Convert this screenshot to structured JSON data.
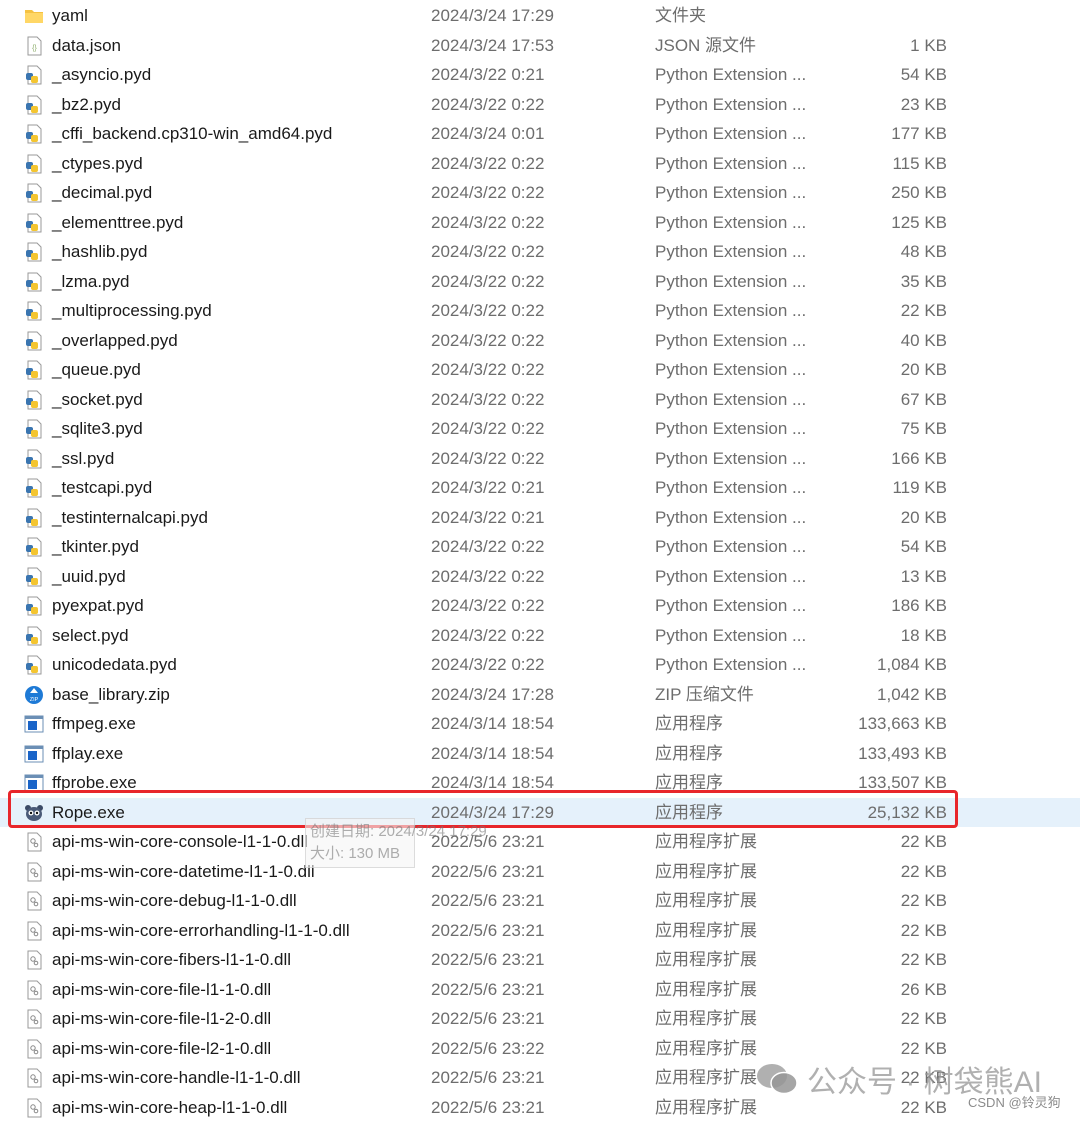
{
  "files": [
    {
      "name": "yaml",
      "date": "2024/3/24 17:29",
      "type": "文件夹",
      "size": "",
      "icon": "folder"
    },
    {
      "name": "data.json",
      "date": "2024/3/24 17:53",
      "type": "JSON 源文件",
      "size": "1 KB",
      "icon": "json"
    },
    {
      "name": "_asyncio.pyd",
      "date": "2024/3/22 0:21",
      "type": "Python Extension ...",
      "size": "54 KB",
      "icon": "python"
    },
    {
      "name": "_bz2.pyd",
      "date": "2024/3/22 0:22",
      "type": "Python Extension ...",
      "size": "23 KB",
      "icon": "python"
    },
    {
      "name": "_cffi_backend.cp310-win_amd64.pyd",
      "date": "2024/3/24 0:01",
      "type": "Python Extension ...",
      "size": "177 KB",
      "icon": "python"
    },
    {
      "name": "_ctypes.pyd",
      "date": "2024/3/22 0:22",
      "type": "Python Extension ...",
      "size": "115 KB",
      "icon": "python"
    },
    {
      "name": "_decimal.pyd",
      "date": "2024/3/22 0:22",
      "type": "Python Extension ...",
      "size": "250 KB",
      "icon": "python"
    },
    {
      "name": "_elementtree.pyd",
      "date": "2024/3/22 0:22",
      "type": "Python Extension ...",
      "size": "125 KB",
      "icon": "python"
    },
    {
      "name": "_hashlib.pyd",
      "date": "2024/3/22 0:22",
      "type": "Python Extension ...",
      "size": "48 KB",
      "icon": "python"
    },
    {
      "name": "_lzma.pyd",
      "date": "2024/3/22 0:22",
      "type": "Python Extension ...",
      "size": "35 KB",
      "icon": "python"
    },
    {
      "name": "_multiprocessing.pyd",
      "date": "2024/3/22 0:22",
      "type": "Python Extension ...",
      "size": "22 KB",
      "icon": "python"
    },
    {
      "name": "_overlapped.pyd",
      "date": "2024/3/22 0:22",
      "type": "Python Extension ...",
      "size": "40 KB",
      "icon": "python"
    },
    {
      "name": "_queue.pyd",
      "date": "2024/3/22 0:22",
      "type": "Python Extension ...",
      "size": "20 KB",
      "icon": "python"
    },
    {
      "name": "_socket.pyd",
      "date": "2024/3/22 0:22",
      "type": "Python Extension ...",
      "size": "67 KB",
      "icon": "python"
    },
    {
      "name": "_sqlite3.pyd",
      "date": "2024/3/22 0:22",
      "type": "Python Extension ...",
      "size": "75 KB",
      "icon": "python"
    },
    {
      "name": "_ssl.pyd",
      "date": "2024/3/22 0:22",
      "type": "Python Extension ...",
      "size": "166 KB",
      "icon": "python"
    },
    {
      "name": "_testcapi.pyd",
      "date": "2024/3/22 0:21",
      "type": "Python Extension ...",
      "size": "119 KB",
      "icon": "python"
    },
    {
      "name": "_testinternalcapi.pyd",
      "date": "2024/3/22 0:21",
      "type": "Python Extension ...",
      "size": "20 KB",
      "icon": "python"
    },
    {
      "name": "_tkinter.pyd",
      "date": "2024/3/22 0:22",
      "type": "Python Extension ...",
      "size": "54 KB",
      "icon": "python"
    },
    {
      "name": "_uuid.pyd",
      "date": "2024/3/22 0:22",
      "type": "Python Extension ...",
      "size": "13 KB",
      "icon": "python"
    },
    {
      "name": "pyexpat.pyd",
      "date": "2024/3/22 0:22",
      "type": "Python Extension ...",
      "size": "186 KB",
      "icon": "python"
    },
    {
      "name": "select.pyd",
      "date": "2024/3/22 0:22",
      "type": "Python Extension ...",
      "size": "18 KB",
      "icon": "python"
    },
    {
      "name": "unicodedata.pyd",
      "date": "2024/3/22 0:22",
      "type": "Python Extension ...",
      "size": "1,084 KB",
      "icon": "python"
    },
    {
      "name": "base_library.zip",
      "date": "2024/3/24 17:28",
      "type": "ZIP 压缩文件",
      "size": "1,042 KB",
      "icon": "zip"
    },
    {
      "name": "ffmpeg.exe",
      "date": "2024/3/14 18:54",
      "type": "应用程序",
      "size": "133,663 KB",
      "icon": "exe"
    },
    {
      "name": "ffplay.exe",
      "date": "2024/3/14 18:54",
      "type": "应用程序",
      "size": "133,493 KB",
      "icon": "exe"
    },
    {
      "name": "ffprobe.exe",
      "date": "2024/3/14 18:54",
      "type": "应用程序",
      "size": "133,507 KB",
      "icon": "exe"
    },
    {
      "name": "Rope.exe",
      "date": "2024/3/24 17:29",
      "type": "应用程序",
      "size": "25,132 KB",
      "icon": "rope",
      "selected": true
    },
    {
      "name": "api-ms-win-core-console-l1-1-0.dll",
      "date": "2022/5/6 23:21",
      "type": "应用程序扩展",
      "size": "22 KB",
      "icon": "dll"
    },
    {
      "name": "api-ms-win-core-datetime-l1-1-0.dll",
      "date": "2022/5/6 23:21",
      "type": "应用程序扩展",
      "size": "22 KB",
      "icon": "dll"
    },
    {
      "name": "api-ms-win-core-debug-l1-1-0.dll",
      "date": "2022/5/6 23:21",
      "type": "应用程序扩展",
      "size": "22 KB",
      "icon": "dll"
    },
    {
      "name": "api-ms-win-core-errorhandling-l1-1-0.dll",
      "date": "2022/5/6 23:21",
      "type": "应用程序扩展",
      "size": "22 KB",
      "icon": "dll"
    },
    {
      "name": "api-ms-win-core-fibers-l1-1-0.dll",
      "date": "2022/5/6 23:21",
      "type": "应用程序扩展",
      "size": "22 KB",
      "icon": "dll"
    },
    {
      "name": "api-ms-win-core-file-l1-1-0.dll",
      "date": "2022/5/6 23:21",
      "type": "应用程序扩展",
      "size": "26 KB",
      "icon": "dll"
    },
    {
      "name": "api-ms-win-core-file-l1-2-0.dll",
      "date": "2022/5/6 23:21",
      "type": "应用程序扩展",
      "size": "22 KB",
      "icon": "dll"
    },
    {
      "name": "api-ms-win-core-file-l2-1-0.dll",
      "date": "2022/5/6 23:22",
      "type": "应用程序扩展",
      "size": "22 KB",
      "icon": "dll"
    },
    {
      "name": "api-ms-win-core-handle-l1-1-0.dll",
      "date": "2022/5/6 23:21",
      "type": "应用程序扩展",
      "size": "22 KB",
      "icon": "dll"
    },
    {
      "name": "api-ms-win-core-heap-l1-1-0.dll",
      "date": "2022/5/6 23:21",
      "type": "应用程序扩展",
      "size": "22 KB",
      "icon": "dll"
    }
  ],
  "tooltip": {
    "created": "创建日期: 2024/3/24 17:29",
    "size": "大小: 130 MB"
  },
  "watermark": {
    "text": "公众号 · 树袋熊AI",
    "csdn": "CSDN @铃灵狗"
  },
  "colors": {
    "highlight": "#e8262b",
    "selected_row": "#e5f1fb"
  }
}
